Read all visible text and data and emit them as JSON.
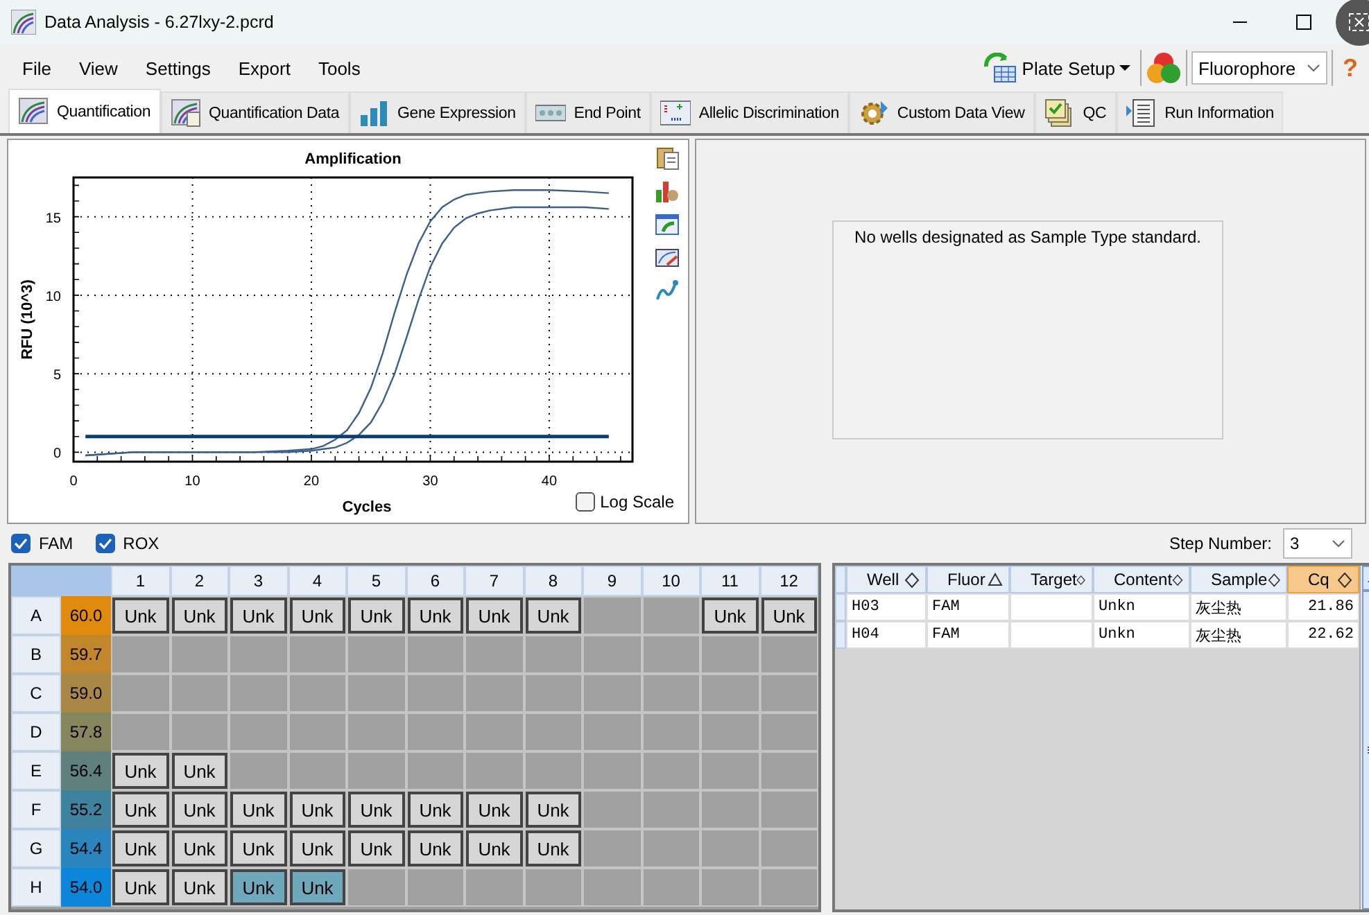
{
  "window": {
    "title": "Data Analysis - 6.27lxy-2.pcrd"
  },
  "menu": [
    "File",
    "View",
    "Settings",
    "Export",
    "Tools"
  ],
  "toolbar": {
    "plate_setup": "Plate Setup",
    "fluorophore": "Fluorophore",
    "help": "?"
  },
  "tabs": [
    {
      "label": "Quantification",
      "selected": true
    },
    {
      "label": "Quantification Data",
      "selected": false
    },
    {
      "label": "Gene Expression",
      "selected": false
    },
    {
      "label": "End Point",
      "selected": false
    },
    {
      "label": "Allelic Discrimination",
      "selected": false
    },
    {
      "label": "Custom Data View",
      "selected": false
    },
    {
      "label": "QC",
      "selected": false
    },
    {
      "label": "Run Information",
      "selected": false
    }
  ],
  "amplification": {
    "log_scale": {
      "label": "Log Scale",
      "checked": false
    },
    "chart_data": {
      "type": "line",
      "title": "Amplification",
      "xlabel": "Cycles",
      "ylabel": "RFU (10^3)",
      "x": [
        1,
        5,
        10,
        15,
        18,
        20,
        21,
        22,
        23,
        24,
        25,
        26,
        27,
        28,
        29,
        30,
        31,
        32,
        33,
        34,
        35,
        37,
        40,
        43,
        45
      ],
      "series": [
        {
          "color": "#3a5f8c",
          "values": [
            -0.2,
            0,
            0,
            0,
            0.1,
            0.2,
            0.4,
            0.8,
            1.4,
            2.5,
            4.1,
            6.3,
            8.9,
            11.3,
            13.3,
            14.7,
            15.6,
            16.1,
            16.4,
            16.5,
            16.6,
            16.7,
            16.7,
            16.6,
            16.5
          ]
        },
        {
          "color": "#3a5f8c",
          "values": [
            -0.2,
            0,
            0,
            0,
            0,
            0.1,
            0.2,
            0.3,
            0.6,
            1.1,
            1.9,
            3.2,
            5.0,
            7.3,
            9.7,
            11.8,
            13.3,
            14.3,
            14.9,
            15.2,
            15.4,
            15.6,
            15.6,
            15.6,
            15.5
          ]
        },
        {
          "color": "#0b3d6e",
          "values": [
            1,
            1,
            1,
            1,
            1,
            1,
            1,
            1,
            1,
            1,
            1,
            1,
            1,
            1,
            1,
            1,
            1,
            1,
            1,
            1,
            1,
            1,
            1,
            1,
            1
          ]
        }
      ],
      "grid": true,
      "xlim": [
        0,
        47
      ],
      "ylim": [
        -0.6,
        17.5
      ],
      "xticks": [
        0,
        10,
        20,
        30,
        40
      ],
      "yticks": [
        0,
        5,
        10,
        15
      ]
    }
  },
  "standard_curve": {
    "message": "No wells designated as Sample Type standard."
  },
  "channels": [
    {
      "label": "FAM",
      "checked": true
    },
    {
      "label": "ROX",
      "checked": true
    }
  ],
  "step": {
    "label": "Step Number:",
    "value": "3"
  },
  "plate": {
    "columns": [
      "1",
      "2",
      "3",
      "4",
      "5",
      "6",
      "7",
      "8",
      "9",
      "10",
      "11",
      "12"
    ],
    "rows": [
      {
        "label": "A",
        "temp": "60.0",
        "color": "#e08a0e",
        "wells": [
          {
            "kind": "sample",
            "label": "Unk",
            "selected": false
          },
          {
            "kind": "sample",
            "label": "Unk",
            "selected": false
          },
          {
            "kind": "sample",
            "label": "Unk",
            "selected": false
          },
          {
            "kind": "sample",
            "label": "Unk",
            "selected": false
          },
          {
            "kind": "sample",
            "label": "Unk",
            "selected": false
          },
          {
            "kind": "sample",
            "label": "Unk",
            "selected": false
          },
          {
            "kind": "sample",
            "label": "Unk",
            "selected": false
          },
          {
            "kind": "sample",
            "label": "Unk",
            "selected": false
          },
          {
            "kind": "empty"
          },
          {
            "kind": "empty"
          },
          {
            "kind": "sample",
            "label": "Unk",
            "selected": false
          },
          {
            "kind": "sample",
            "label": "Unk",
            "selected": false
          }
        ]
      },
      {
        "label": "B",
        "temp": "59.7",
        "color": "#c2862c",
        "wells": [
          {
            "kind": "empty"
          },
          {
            "kind": "empty"
          },
          {
            "kind": "empty"
          },
          {
            "kind": "empty"
          },
          {
            "kind": "empty"
          },
          {
            "kind": "empty"
          },
          {
            "kind": "empty"
          },
          {
            "kind": "empty"
          },
          {
            "kind": "empty"
          },
          {
            "kind": "empty"
          },
          {
            "kind": "empty"
          },
          {
            "kind": "empty"
          }
        ]
      },
      {
        "label": "C",
        "temp": "59.0",
        "color": "#a98744",
        "wells": [
          {
            "kind": "empty"
          },
          {
            "kind": "empty"
          },
          {
            "kind": "empty"
          },
          {
            "kind": "empty"
          },
          {
            "kind": "empty"
          },
          {
            "kind": "empty"
          },
          {
            "kind": "empty"
          },
          {
            "kind": "empty"
          },
          {
            "kind": "empty"
          },
          {
            "kind": "empty"
          },
          {
            "kind": "empty"
          },
          {
            "kind": "empty"
          }
        ]
      },
      {
        "label": "D",
        "temp": "57.8",
        "color": "#85855e",
        "wells": [
          {
            "kind": "empty"
          },
          {
            "kind": "empty"
          },
          {
            "kind": "empty"
          },
          {
            "kind": "empty"
          },
          {
            "kind": "empty"
          },
          {
            "kind": "empty"
          },
          {
            "kind": "empty"
          },
          {
            "kind": "empty"
          },
          {
            "kind": "empty"
          },
          {
            "kind": "empty"
          },
          {
            "kind": "empty"
          },
          {
            "kind": "empty"
          }
        ]
      },
      {
        "label": "E",
        "temp": "56.4",
        "color": "#5f807c",
        "wells": [
          {
            "kind": "sample",
            "label": "Unk",
            "selected": false
          },
          {
            "kind": "sample",
            "label": "Unk",
            "selected": false
          },
          {
            "kind": "empty"
          },
          {
            "kind": "empty"
          },
          {
            "kind": "empty"
          },
          {
            "kind": "empty"
          },
          {
            "kind": "empty"
          },
          {
            "kind": "empty"
          },
          {
            "kind": "empty"
          },
          {
            "kind": "empty"
          },
          {
            "kind": "empty"
          },
          {
            "kind": "empty"
          }
        ]
      },
      {
        "label": "F",
        "temp": "55.2",
        "color": "#3f829e",
        "wells": [
          {
            "kind": "sample",
            "label": "Unk",
            "selected": false
          },
          {
            "kind": "sample",
            "label": "Unk",
            "selected": false
          },
          {
            "kind": "sample",
            "label": "Unk",
            "selected": false
          },
          {
            "kind": "sample",
            "label": "Unk",
            "selected": false
          },
          {
            "kind": "sample",
            "label": "Unk",
            "selected": false
          },
          {
            "kind": "sample",
            "label": "Unk",
            "selected": false
          },
          {
            "kind": "sample",
            "label": "Unk",
            "selected": false
          },
          {
            "kind": "sample",
            "label": "Unk",
            "selected": false
          },
          {
            "kind": "empty"
          },
          {
            "kind": "empty"
          },
          {
            "kind": "empty"
          },
          {
            "kind": "empty"
          }
        ]
      },
      {
        "label": "G",
        "temp": "54.4",
        "color": "#2b84bc",
        "wells": [
          {
            "kind": "sample",
            "label": "Unk",
            "selected": false
          },
          {
            "kind": "sample",
            "label": "Unk",
            "selected": false
          },
          {
            "kind": "sample",
            "label": "Unk",
            "selected": false
          },
          {
            "kind": "sample",
            "label": "Unk",
            "selected": false
          },
          {
            "kind": "sample",
            "label": "Unk",
            "selected": false
          },
          {
            "kind": "sample",
            "label": "Unk",
            "selected": false
          },
          {
            "kind": "sample",
            "label": "Unk",
            "selected": false
          },
          {
            "kind": "sample",
            "label": "Unk",
            "selected": false
          },
          {
            "kind": "empty"
          },
          {
            "kind": "empty"
          },
          {
            "kind": "empty"
          },
          {
            "kind": "empty"
          }
        ]
      },
      {
        "label": "H",
        "temp": "54.0",
        "color": "#0c86d8",
        "wells": [
          {
            "kind": "sample",
            "label": "Unk",
            "selected": false
          },
          {
            "kind": "sample",
            "label": "Unk",
            "selected": false
          },
          {
            "kind": "sample",
            "label": "Unk",
            "selected": true
          },
          {
            "kind": "sample",
            "label": "Unk",
            "selected": true
          },
          {
            "kind": "empty"
          },
          {
            "kind": "empty"
          },
          {
            "kind": "empty"
          },
          {
            "kind": "empty"
          },
          {
            "kind": "empty"
          },
          {
            "kind": "empty"
          },
          {
            "kind": "empty"
          },
          {
            "kind": "empty"
          }
        ]
      }
    ]
  },
  "table": {
    "columns": [
      {
        "label": "Well",
        "sorted": false,
        "highlighted": false
      },
      {
        "label": "Fluor",
        "sorted": true,
        "highlighted": false
      },
      {
        "label": "Target",
        "sorted": false,
        "highlighted": false
      },
      {
        "label": "Content",
        "sorted": false,
        "highlighted": false
      },
      {
        "label": "Sample",
        "sorted": false,
        "highlighted": false
      },
      {
        "label": "Cq",
        "sorted": false,
        "highlighted": true
      }
    ],
    "rows": [
      [
        "H03",
        "FAM",
        "",
        "Unkn",
        "灰尘热",
        "21.86"
      ],
      [
        "H04",
        "FAM",
        "",
        "Unkn",
        "灰尘热",
        "22.62"
      ]
    ]
  }
}
